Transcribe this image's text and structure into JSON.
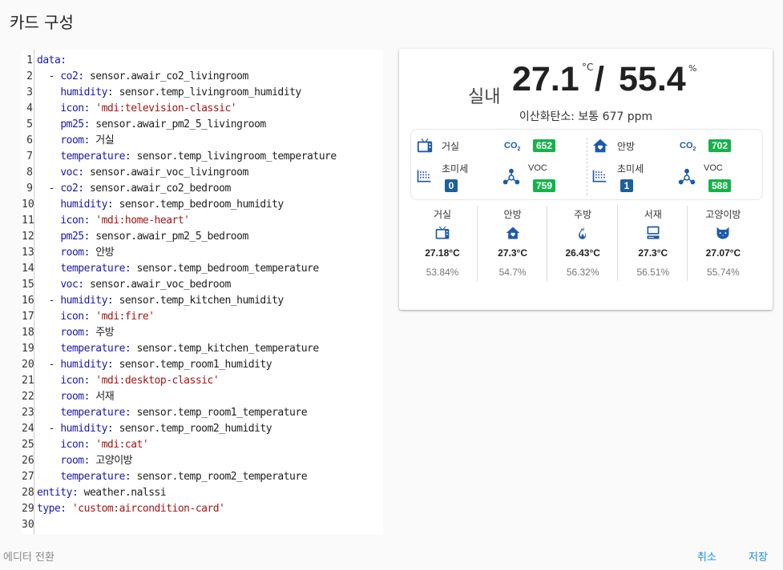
{
  "dialog": {
    "title": "카드 구성"
  },
  "editor": {
    "lines": [
      [
        "",
        [
          [
            "key",
            "data:"
          ]
        ]
      ],
      [
        "  - ",
        [
          [
            "key",
            "co2:"
          ],
          [
            "val",
            " sensor.awair_co2_livingroom"
          ]
        ]
      ],
      [
        "    ",
        [
          [
            "key",
            "humidity:"
          ],
          [
            "val",
            " sensor.temp_livingroom_humidity"
          ]
        ]
      ],
      [
        "    ",
        [
          [
            "key",
            "icon:"
          ],
          [
            "str",
            " 'mdi:television-classic'"
          ]
        ]
      ],
      [
        "    ",
        [
          [
            "key",
            "pm25:"
          ],
          [
            "val",
            " sensor.awair_pm2_5_livingroom"
          ]
        ]
      ],
      [
        "    ",
        [
          [
            "key",
            "room:"
          ],
          [
            "val",
            " 거실"
          ]
        ]
      ],
      [
        "    ",
        [
          [
            "key",
            "temperature:"
          ],
          [
            "val",
            " sensor.temp_livingroom_temperature"
          ]
        ]
      ],
      [
        "    ",
        [
          [
            "key",
            "voc:"
          ],
          [
            "val",
            " sensor.awair_voc_livingroom"
          ]
        ]
      ],
      [
        "  - ",
        [
          [
            "key",
            "co2:"
          ],
          [
            "val",
            " sensor.awair_co2_bedroom"
          ]
        ]
      ],
      [
        "    ",
        [
          [
            "key",
            "humidity:"
          ],
          [
            "val",
            " sensor.temp_bedroom_humidity"
          ]
        ]
      ],
      [
        "    ",
        [
          [
            "key",
            "icon:"
          ],
          [
            "str",
            " 'mdi:home-heart'"
          ]
        ]
      ],
      [
        "    ",
        [
          [
            "key",
            "pm25:"
          ],
          [
            "val",
            " sensor.awair_pm2_5_bedroom"
          ]
        ]
      ],
      [
        "    ",
        [
          [
            "key",
            "room:"
          ],
          [
            "val",
            " 안방"
          ]
        ]
      ],
      [
        "    ",
        [
          [
            "key",
            "temperature:"
          ],
          [
            "val",
            " sensor.temp_bedroom_temperature"
          ]
        ]
      ],
      [
        "    ",
        [
          [
            "key",
            "voc:"
          ],
          [
            "val",
            " sensor.awair_voc_bedroom"
          ]
        ]
      ],
      [
        "  - ",
        [
          [
            "key",
            "humidity:"
          ],
          [
            "val",
            " sensor.temp_kitchen_humidity"
          ]
        ]
      ],
      [
        "    ",
        [
          [
            "key",
            "icon:"
          ],
          [
            "str",
            " 'mdi:fire'"
          ]
        ]
      ],
      [
        "    ",
        [
          [
            "key",
            "room:"
          ],
          [
            "val",
            " 주방"
          ]
        ]
      ],
      [
        "    ",
        [
          [
            "key",
            "temperature:"
          ],
          [
            "val",
            " sensor.temp_kitchen_temperature"
          ]
        ]
      ],
      [
        "  - ",
        [
          [
            "key",
            "humidity:"
          ],
          [
            "val",
            " sensor.temp_room1_humidity"
          ]
        ]
      ],
      [
        "    ",
        [
          [
            "key",
            "icon:"
          ],
          [
            "str",
            " 'mdi:desktop-classic'"
          ]
        ]
      ],
      [
        "    ",
        [
          [
            "key",
            "room:"
          ],
          [
            "val",
            " 서재"
          ]
        ]
      ],
      [
        "    ",
        [
          [
            "key",
            "temperature:"
          ],
          [
            "val",
            " sensor.temp_room1_temperature"
          ]
        ]
      ],
      [
        "  - ",
        [
          [
            "key",
            "humidity:"
          ],
          [
            "val",
            " sensor.temp_room2_humidity"
          ]
        ]
      ],
      [
        "    ",
        [
          [
            "key",
            "icon:"
          ],
          [
            "str",
            " 'mdi:cat'"
          ]
        ]
      ],
      [
        "    ",
        [
          [
            "key",
            "room:"
          ],
          [
            "val",
            " 고양이방"
          ]
        ]
      ],
      [
        "    ",
        [
          [
            "key",
            "temperature:"
          ],
          [
            "val",
            " sensor.temp_room2_temperature"
          ]
        ]
      ],
      [
        "",
        [
          [
            "key",
            "entity:"
          ],
          [
            "val",
            " weather.nalssi"
          ]
        ]
      ],
      [
        "",
        [
          [
            "key",
            "type:"
          ],
          [
            "str",
            " 'custom:aircondition-card'"
          ]
        ]
      ],
      [
        "",
        []
      ]
    ]
  },
  "card": {
    "hero": {
      "label": "실내",
      "temperature": "27.1",
      "temperature_unit": "°C",
      "separator": "/",
      "humidity": "55.4",
      "humidity_unit": "%"
    },
    "co2_summary": "이산화탄소: 보통 677 ppm",
    "co2_label": "CO",
    "co2_label_sub": "2",
    "pm_label": "초미세",
    "voc_label": "VOC",
    "detail_rooms": [
      {
        "name": "거실",
        "icon": "television-classic-icon",
        "co2": "652",
        "pm25": "0",
        "voc": "759"
      },
      {
        "name": "안방",
        "icon": "home-heart-icon",
        "co2": "702",
        "pm25": "1",
        "voc": "588"
      }
    ],
    "rooms": [
      {
        "name": "거실",
        "icon": "television-classic-icon",
        "temperature": "27.18°C",
        "humidity": "53.84%"
      },
      {
        "name": "안방",
        "icon": "home-heart-icon",
        "temperature": "27.3°C",
        "humidity": "54.7%"
      },
      {
        "name": "주방",
        "icon": "fire-icon",
        "temperature": "26.43°C",
        "humidity": "56.32%"
      },
      {
        "name": "서재",
        "icon": "desktop-classic-icon",
        "temperature": "27.3°C",
        "humidity": "56.51%"
      },
      {
        "name": "고양이방",
        "icon": "cat-icon",
        "temperature": "27.07°C",
        "humidity": "55.74%"
      }
    ],
    "colors": {
      "icon": "#1e5aa8",
      "badge_green": "#16b24a",
      "badge_blue": "#1f5f99"
    }
  },
  "footer": {
    "toggle_editor": "에디터 전환",
    "cancel": "취소",
    "save": "저장"
  }
}
